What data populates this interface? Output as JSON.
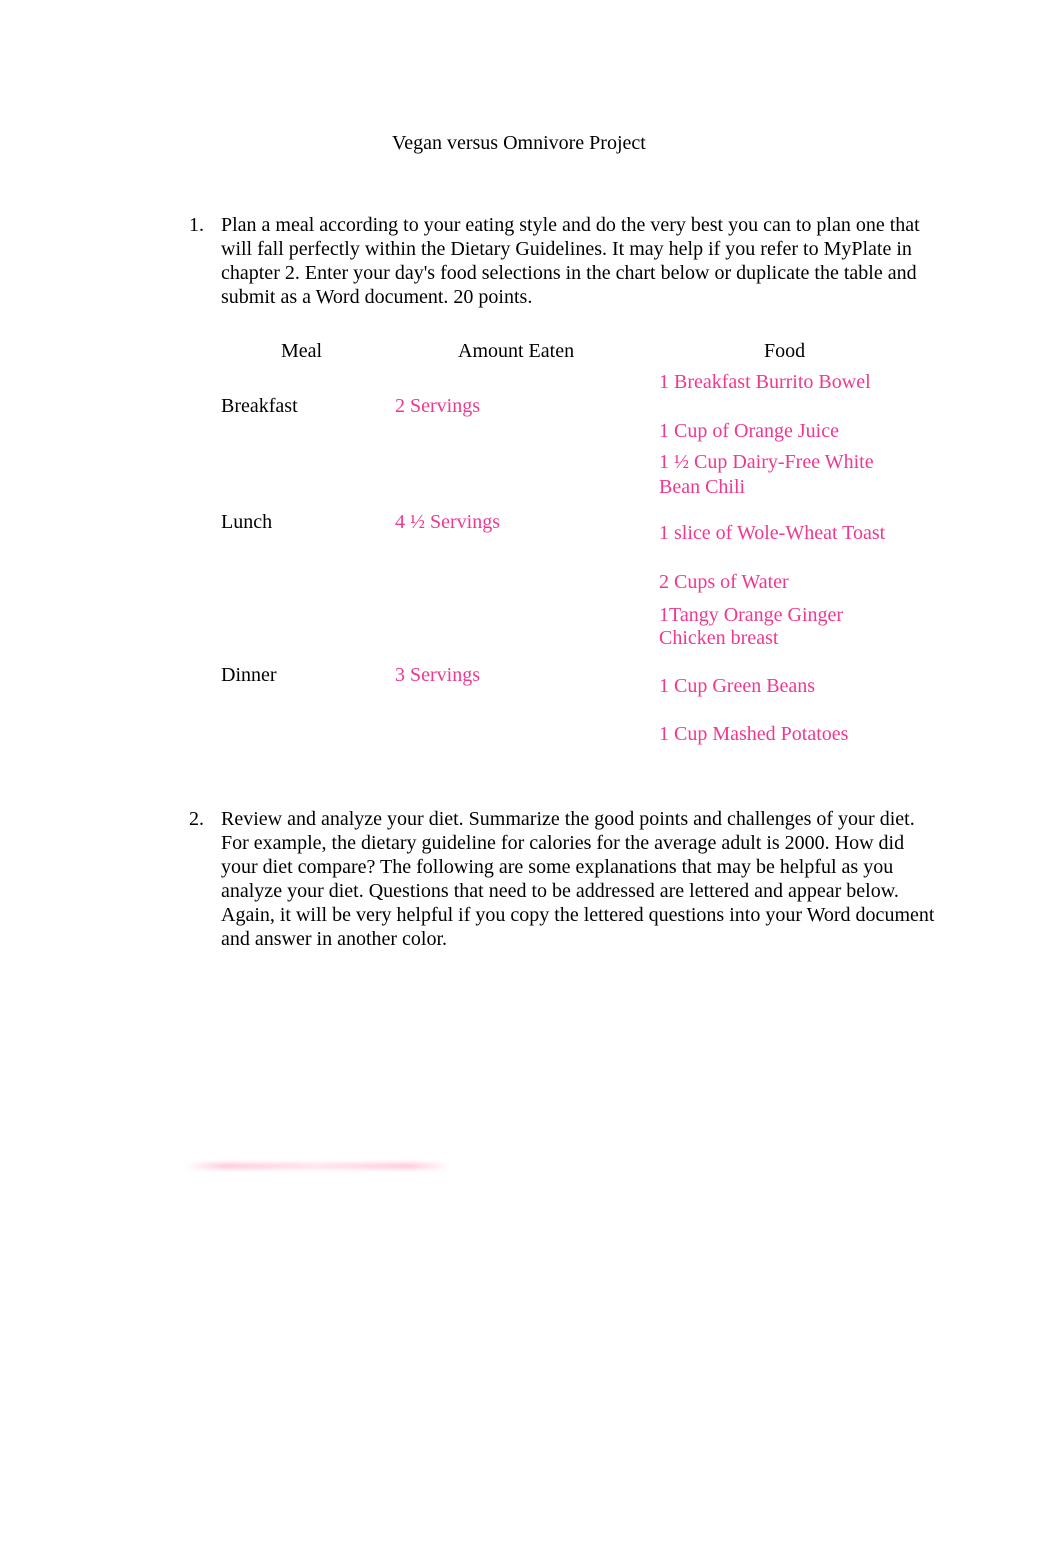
{
  "document": {
    "title": "Vegan versus Omnivore Project",
    "items": [
      {
        "number": "1.",
        "text": "Plan a meal according to your eating style and do the very best you can to plan one that will fall perfectly within the Dietary Guidelines. It may help if you refer to MyPlate in chapter 2. Enter your day's food selections in the chart below or duplicate the table and submit as a Word document. 20 points."
      },
      {
        "number": "2.",
        "text": "Review and analyze your diet. Summarize the good points and challenges of your diet. For example, the dietary guideline for calories for the average adult is 2000. How did your diet compare? The following are some explanations that may be helpful as you analyze your diet. Questions that need to be addressed are lettered and appear below. Again, it will be very helpful if you copy the lettered questions into your Word document and answer in another color."
      }
    ],
    "table": {
      "headers": [
        "Meal",
        "Amount Eaten",
        "Food"
      ],
      "rows": [
        {
          "meal": "Breakfast",
          "amount": "2 Servings"
        },
        {
          "meal": "Lunch",
          "amount": "4 ½ Servings"
        },
        {
          "meal": "Dinner",
          "amount": "3 Servings"
        }
      ],
      "foods": [
        " 1 Breakfast Burrito Bowel",
        "1 Cup of Orange Juice",
        "1 ½ Cup Dairy-Free White",
        "Bean Chili",
        "1 slice of Wole-Wheat Toast",
        "2 Cups of Water",
        " 1Tangy Orange Ginger",
        "Chicken breast",
        "1 Cup Green Beans",
        "1 Cup Mashed Potatoes"
      ]
    },
    "answer_color": "#f0388f"
  }
}
